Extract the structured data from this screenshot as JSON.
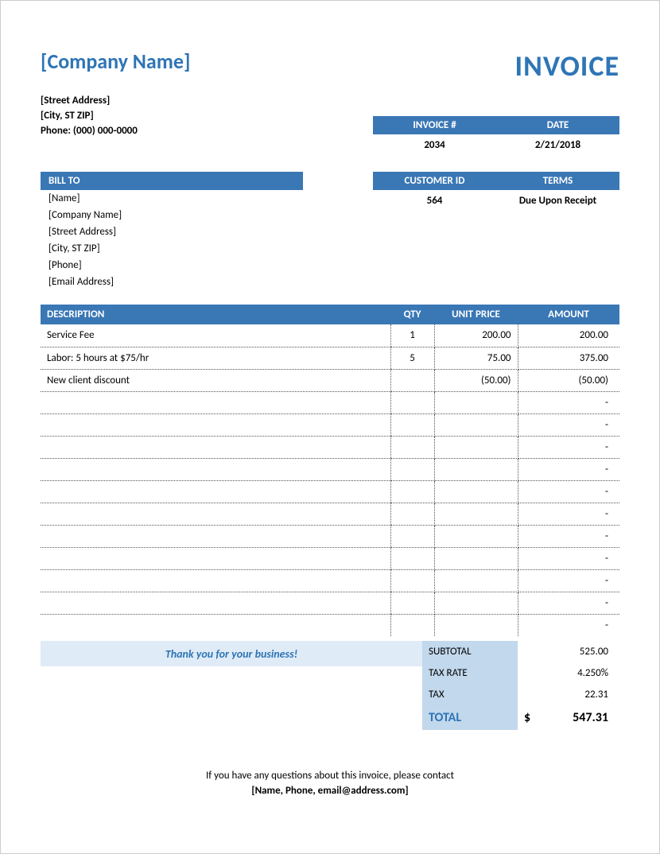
{
  "header": {
    "company_name": "[Company Name]",
    "title": "INVOICE",
    "street": "[Street Address]",
    "city": "[City, ST  ZIP]",
    "phone": "Phone: (000) 000-0000"
  },
  "meta": {
    "invoice_hdr": "INVOICE #",
    "date_hdr": "DATE",
    "invoice_no": "2034",
    "date": "2/21/2018",
    "customer_hdr": "CUSTOMER ID",
    "terms_hdr": "TERMS",
    "customer_id": "564",
    "terms": "Due Upon Receipt"
  },
  "bill_to": {
    "header": "BILL TO",
    "name": "[Name]",
    "company": "[Company Name]",
    "street": "[Street Address]",
    "city": "[City, ST  ZIP]",
    "phone": "[Phone]",
    "email": "[Email Address]"
  },
  "items": {
    "headers": {
      "desc": "DESCRIPTION",
      "qty": "QTY",
      "price": "UNIT PRICE",
      "amount": "AMOUNT"
    },
    "rows": [
      {
        "desc": "Service Fee",
        "qty": "1",
        "price": "200.00",
        "amount": "200.00"
      },
      {
        "desc": "Labor: 5 hours at $75/hr",
        "qty": "5",
        "price": "75.00",
        "amount": "375.00"
      },
      {
        "desc": "New client discount",
        "qty": "",
        "price": "(50.00)",
        "amount": "(50.00)"
      },
      {
        "desc": "",
        "qty": "",
        "price": "",
        "amount": "-"
      },
      {
        "desc": "",
        "qty": "",
        "price": "",
        "amount": "-"
      },
      {
        "desc": "",
        "qty": "",
        "price": "",
        "amount": "-"
      },
      {
        "desc": "",
        "qty": "",
        "price": "",
        "amount": "-"
      },
      {
        "desc": "",
        "qty": "",
        "price": "",
        "amount": "-"
      },
      {
        "desc": "",
        "qty": "",
        "price": "",
        "amount": "-"
      },
      {
        "desc": "",
        "qty": "",
        "price": "",
        "amount": "-"
      },
      {
        "desc": "",
        "qty": "",
        "price": "",
        "amount": "-"
      },
      {
        "desc": "",
        "qty": "",
        "price": "",
        "amount": "-"
      },
      {
        "desc": "",
        "qty": "",
        "price": "",
        "amount": "-"
      },
      {
        "desc": "",
        "qty": "",
        "price": "",
        "amount": "-"
      }
    ]
  },
  "totals": {
    "thanks": "Thank you for your business!",
    "subtotal_label": "SUBTOTAL",
    "subtotal": "525.00",
    "tax_rate_label": "TAX RATE",
    "tax_rate": "4.250%",
    "tax_label": "TAX",
    "tax": "22.31",
    "total_label": "TOTAL",
    "currency": "$",
    "total": "547.31"
  },
  "footer": {
    "line1": "If you have any questions about this invoice, please contact",
    "contact": "[Name, Phone, email@address.com]"
  }
}
